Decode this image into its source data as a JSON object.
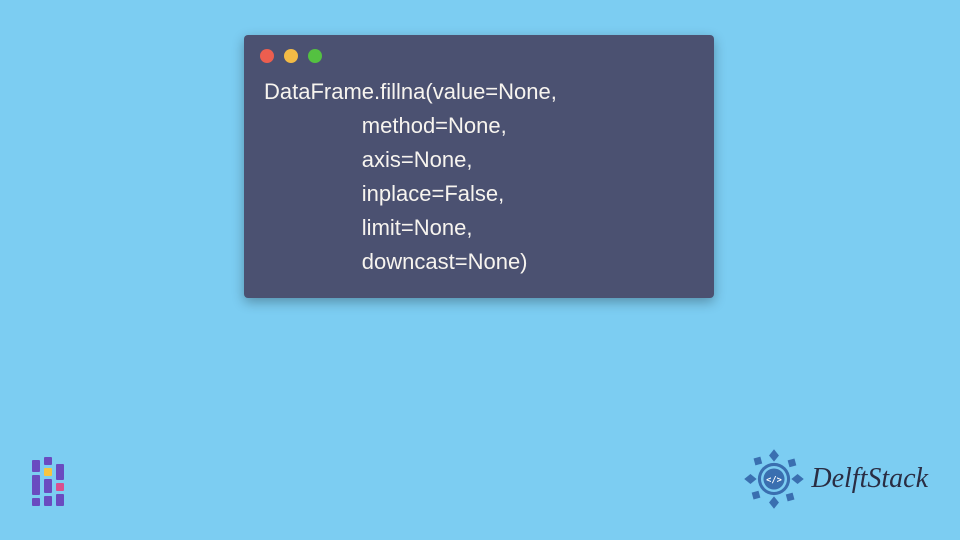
{
  "code": {
    "lines": [
      "DataFrame.fillna(value=None,",
      "                method=None,",
      "                axis=None,",
      "                inplace=False,",
      "                limit=None,",
      "                downcast=None)"
    ]
  },
  "window": {
    "dots": [
      "red",
      "yellow",
      "green"
    ]
  },
  "brand": {
    "name": "DelftStack",
    "badge_color": "#3a6fb0"
  },
  "colors": {
    "background": "#7ccdf2",
    "window_bg": "#4b5171",
    "code_fg": "#f7f4ef"
  }
}
